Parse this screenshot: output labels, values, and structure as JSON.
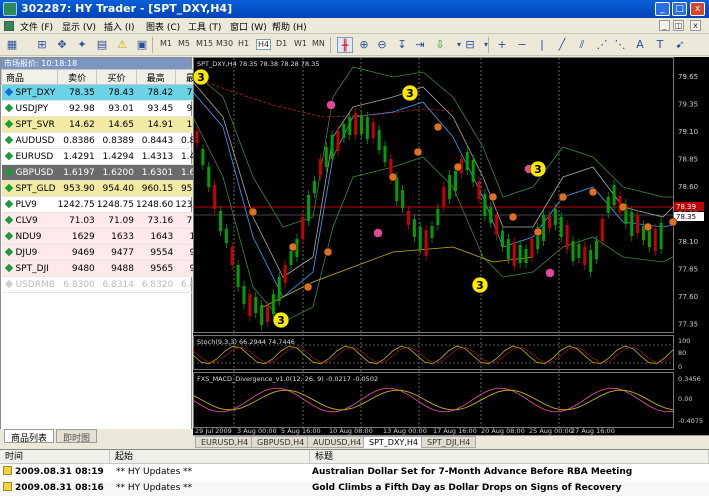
{
  "window": {
    "title": "302287: HY Trader - [SPT_DXY,H4]",
    "minimize": "_",
    "maximize": "□",
    "close": "x"
  },
  "menu": {
    "items": [
      "文件 (F)",
      "显示 (V)",
      "插入 (I)",
      "图表 (C)",
      "工具 (T)",
      "窗口 (W)",
      "帮助 (H)"
    ],
    "mdi_minimize": "_",
    "mdi_restore": "◫",
    "mdi_close": "x"
  },
  "toolbar": {
    "timeframes": [
      "M1",
      "M5",
      "M15",
      "M30",
      "H1",
      "H4",
      "D1",
      "W1",
      "MN"
    ],
    "active_timeframe": "H4"
  },
  "market_watch": {
    "title": "市场报价: 10:18:18",
    "columns": [
      "商品",
      "卖价",
      "买价",
      "最高",
      "最低"
    ],
    "rows": [
      {
        "symbol": "SPT_DXY",
        "bid": "78.35",
        "ask": "78.43",
        "high": "78.42",
        "low": "78.13",
        "style": "sel"
      },
      {
        "symbol": "USDJPY",
        "bid": "92.98",
        "ask": "93.01",
        "high": "93.45",
        "low": "92.52",
        "style": ""
      },
      {
        "symbol": "SPT_SVR",
        "bid": "14.62",
        "ask": "14.65",
        "high": "14.91",
        "low": "14.59",
        "style": "gold"
      },
      {
        "symbol": "AUDUSD",
        "bid": "0.8386",
        "ask": "0.8389",
        "high": "0.8443",
        "low": "0.8366",
        "style": ""
      },
      {
        "symbol": "EURUSD",
        "bid": "1.4291",
        "ask": "1.4294",
        "high": "1.4313",
        "low": "1.4255",
        "style": ""
      },
      {
        "symbol": "GBPUSD",
        "bid": "1.6197",
        "ask": "1.6200",
        "high": "1.6301",
        "low": "1.6182",
        "style": "dark"
      },
      {
        "symbol": "SPT_GLD",
        "bid": "953.90",
        "ask": "954.40",
        "high": "960.15",
        "low": "952.65",
        "style": "gold"
      },
      {
        "symbol": "PLV9",
        "bid": "1242.75",
        "ask": "1248.75",
        "high": "1248.60",
        "low": "1238.05",
        "style": ""
      },
      {
        "symbol": "CLV9",
        "bid": "71.03",
        "ask": "71.09",
        "high": "73.16",
        "low": "71.03",
        "style": "pink"
      },
      {
        "symbol": "NDU9",
        "bid": "1629",
        "ask": "1633",
        "high": "1643",
        "low": "1624",
        "style": "pink"
      },
      {
        "symbol": "DJU9",
        "bid": "9469",
        "ask": "9477",
        "high": "9554",
        "low": "9453",
        "style": "pink"
      },
      {
        "symbol": "SPT_DJI",
        "bid": "9480",
        "ask": "9488",
        "high": "9565",
        "low": "9464",
        "style": "pink"
      },
      {
        "symbol": "USDRMB",
        "bid": "6.8300",
        "ask": "6.8314",
        "high": "6.8320",
        "low": "6.8295",
        "style": "muted"
      }
    ],
    "tabs": [
      "商品列表",
      "即时图"
    ]
  },
  "chart": {
    "header": "SPT_DXY,H4 78.35 78.38 78.28 78.35",
    "price_labels": [
      "79.65",
      "79.35",
      "79.10",
      "78.85",
      "78.60",
      "78.35",
      "78.10",
      "77.85",
      "77.60",
      "77.35"
    ],
    "current_price": "78.35",
    "current_price_tag2": "78.39",
    "stoch_label": "Stoch(9,3,3) 66.2944 74.7446",
    "stoch_levels": [
      "100",
      "80",
      "0"
    ],
    "macd_label": "FXS_MACD_Divergence_v1.0(12, 26, 9) -0.0217 -0.0502",
    "macd_levels": [
      "0.3456",
      "0.00",
      "-0.4075"
    ],
    "date_labels": [
      "29 Jul 2009",
      "3 Aug 00:00",
      "5 Aug 16:00",
      "10 Aug 08:00",
      "13 Aug 00:00",
      "17 Aug 16:00",
      "20 Aug 08:00",
      "25 Aug 00:00",
      "27 Aug 16:00"
    ],
    "wave_label_big": "3",
    "colors": {
      "bull": "#00a000",
      "bear": "#c80000",
      "bg": "#000000",
      "marker_yellow": "#ffe800",
      "marker_pink": "#e0489a",
      "marker_orange": "#e0701e"
    }
  },
  "chart_tabs": [
    "EURUSD,H4",
    "GBPUSD,H4",
    "AUDUSD,H4",
    "SPT_DXY,H4",
    "SPT_DJI,H4"
  ],
  "chart_tab_active": "SPT_DXY,H4",
  "news": {
    "columns": [
      "时间",
      "起始",
      "标题"
    ],
    "rows": [
      {
        "time": "2009.08.31 08:19",
        "source": "** HY Updates **",
        "title": "Australian Dollar Set for 7-Month Advance Before RBA Meeting"
      },
      {
        "time": "2009.08.31 08:16",
        "source": "** HY Updates **",
        "title": "Gold Climbs a Fifth Day as Dollar Drops on Signs of Recovery"
      }
    ]
  }
}
